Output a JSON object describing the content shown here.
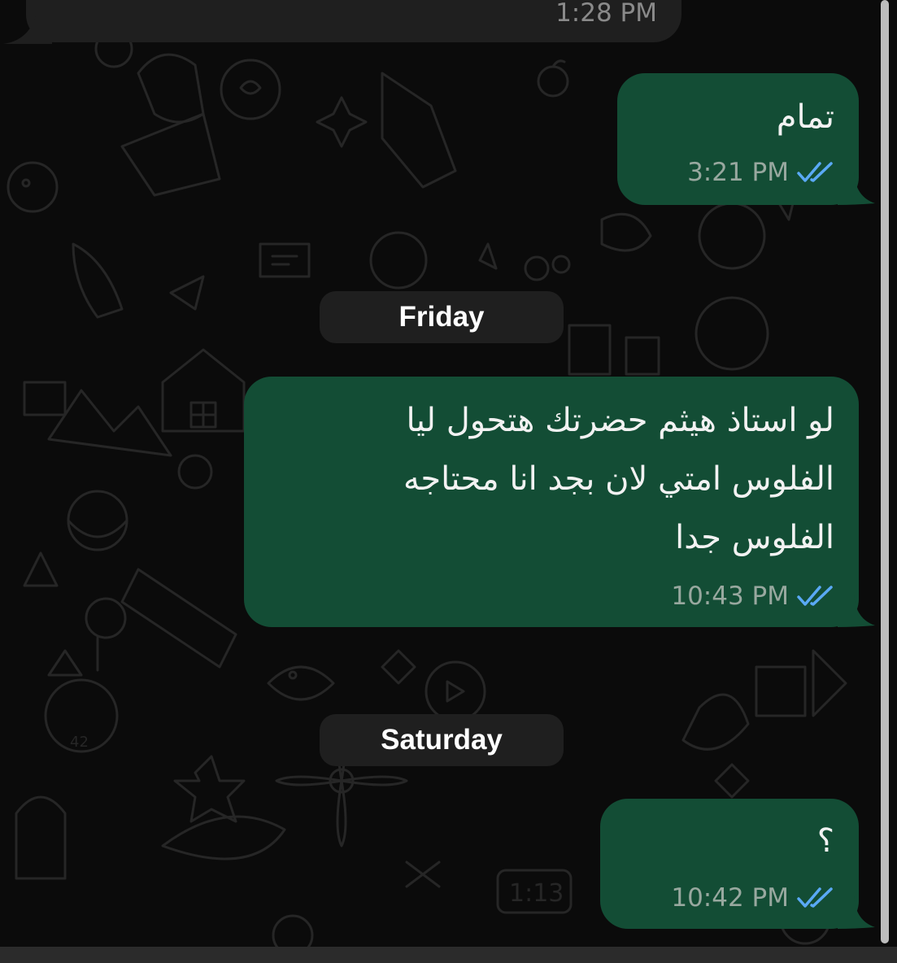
{
  "chat": {
    "day_separators": [
      "Friday",
      "Saturday"
    ],
    "messages": [
      {
        "direction": "incoming",
        "text": "",
        "time": "1:28 PM"
      },
      {
        "direction": "outgoing",
        "text": "تمام",
        "time": "3:21 PM",
        "status": "read"
      },
      {
        "direction": "outgoing",
        "text": "لو استاذ هيثم حضرتك هتحول ليا\nالفلوس امتي لان بجد انا محتاجه\nالفلوس جدا",
        "time": "10:43 PM",
        "status": "read"
      },
      {
        "direction": "outgoing",
        "text": "؟",
        "time": "10:42 PM",
        "status": "read"
      }
    ]
  },
  "colors": {
    "background": "#0b0b0b",
    "outgoing_bubble": "#134d35",
    "incoming_bubble": "#1f1f1f",
    "read_ticks": "#5aa9f5",
    "time_text": "#98a89f"
  },
  "icons": {
    "read_receipt": "double-check-icon",
    "wallpaper": "doodle-pattern"
  }
}
